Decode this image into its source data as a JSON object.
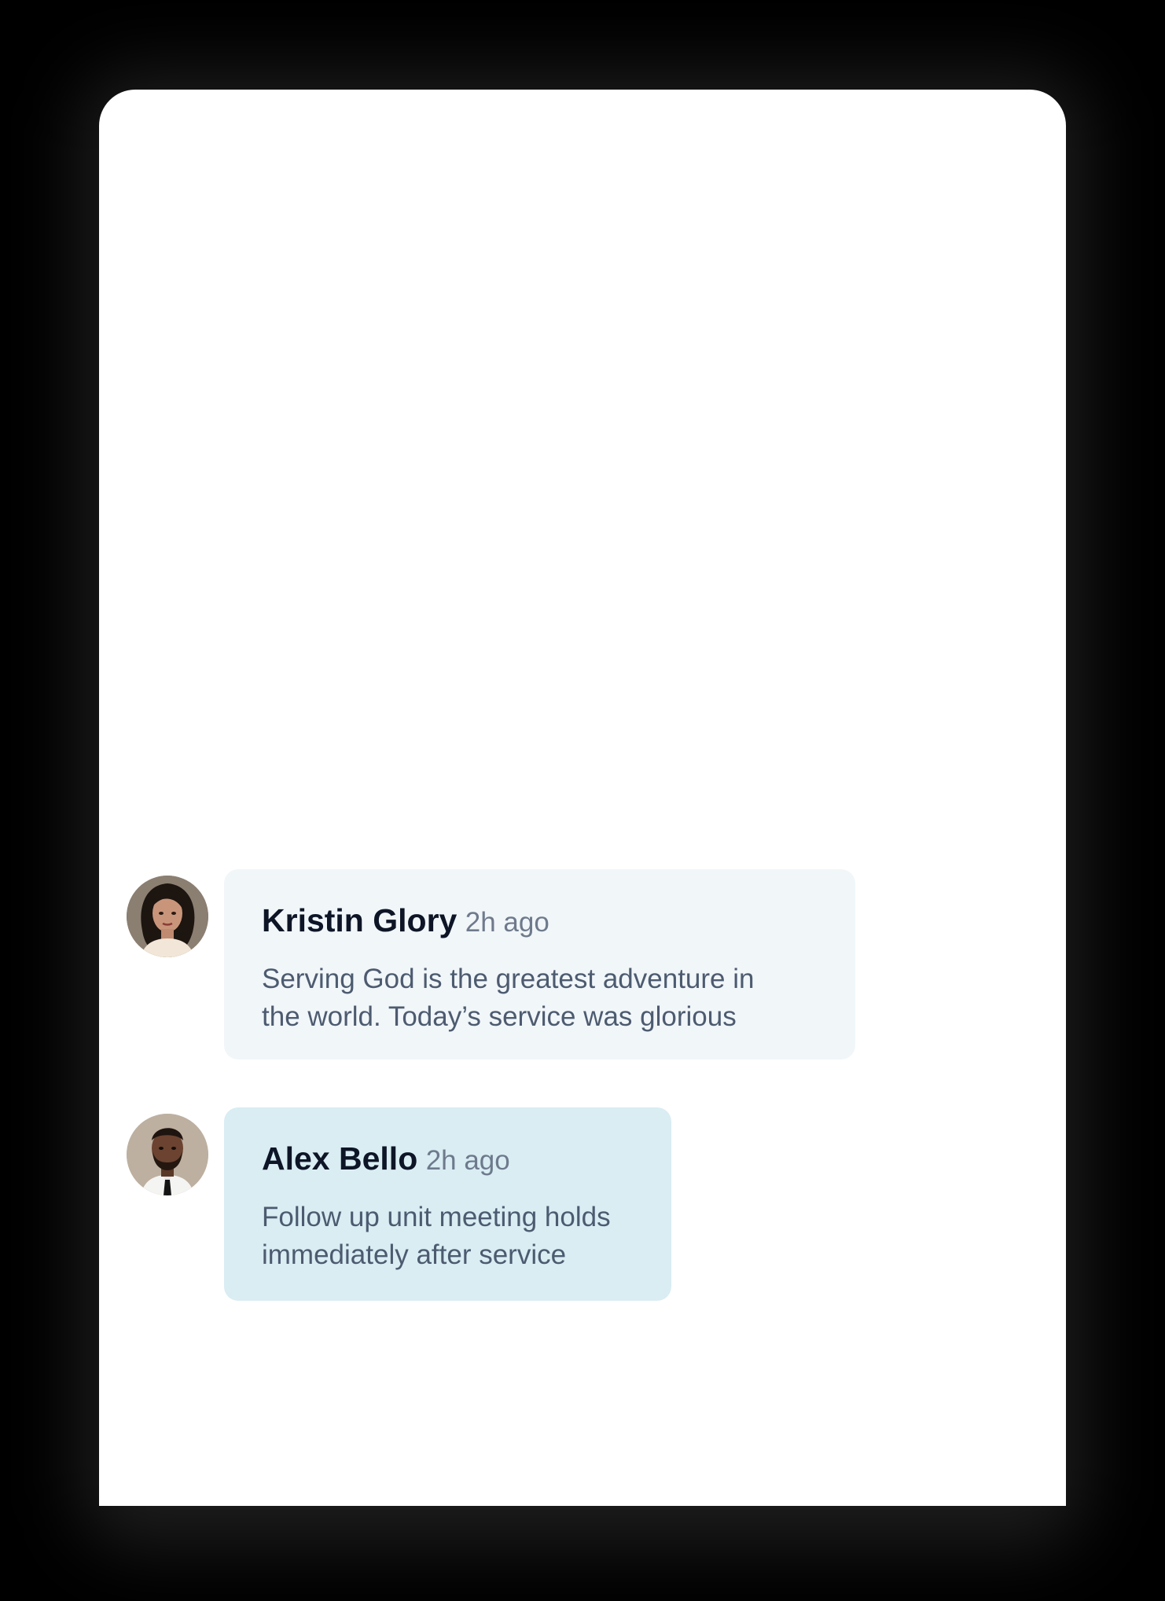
{
  "colors": {
    "page_background": "#000000",
    "card_background": "#ffffff",
    "bubble_light": "#f1f6f9",
    "bubble_accent": "#d9edf3",
    "author_text": "#0d1526",
    "timestamp_text": "#6e7a8c",
    "message_text": "#4d5b70"
  },
  "messages": [
    {
      "author": "Kristin Glory",
      "time": "2h ago",
      "line1": "Serving God is the greatest adventure in",
      "line2": "the world. Today’s service was glorious",
      "avatar": "woman-avatar"
    },
    {
      "author": "Alex Bello",
      "time": "2h ago",
      "line1": "Follow up unit meeting holds",
      "line2": "immediately after service",
      "avatar": "man-avatar"
    }
  ]
}
